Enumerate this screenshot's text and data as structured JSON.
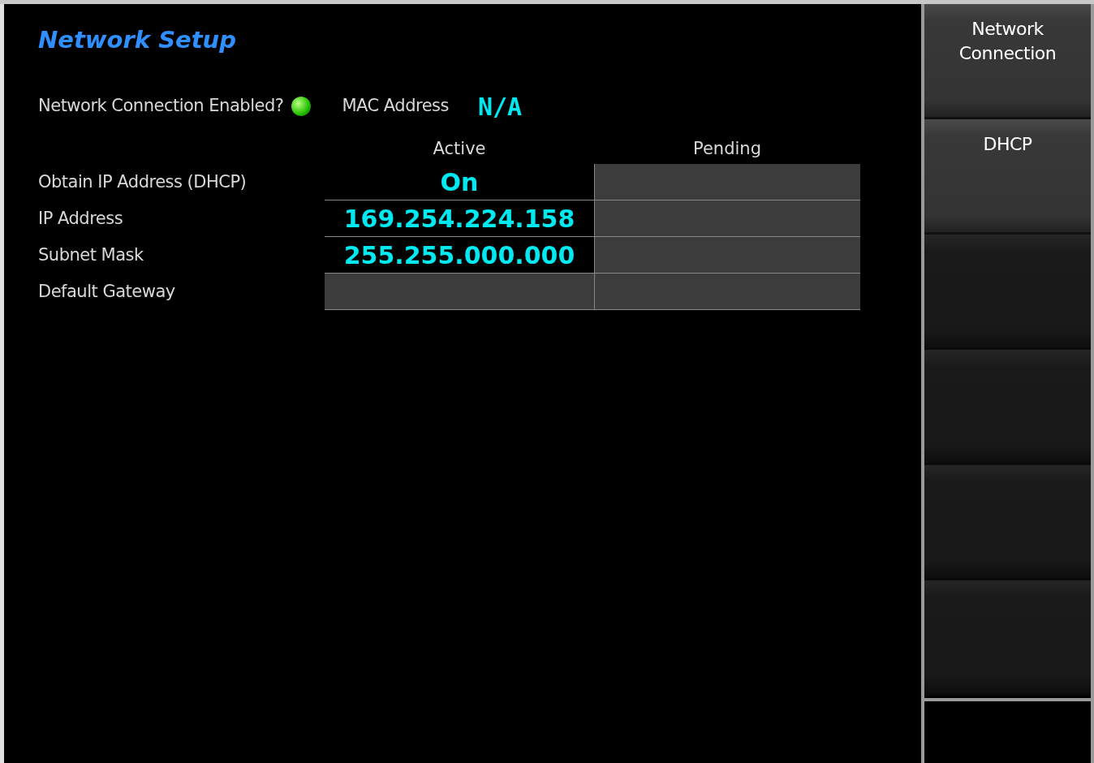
{
  "title": "Network Setup",
  "status": {
    "label": "Network Connection Enabled?",
    "enabled": true,
    "mac_label": "MAC Address",
    "mac_value": "N/A"
  },
  "table": {
    "columns": [
      "Active",
      "Pending"
    ],
    "rows": [
      {
        "label": "Obtain IP Address (DHCP)",
        "active": "On"
      },
      {
        "label": "IP Address",
        "active": "169.254.224.158"
      },
      {
        "label": "Subnet Mask",
        "active": "255.255.000.000"
      },
      {
        "label": "Default Gateway"
      }
    ]
  },
  "softkeys": [
    {
      "kind": "label",
      "label": "Network Connection"
    },
    {
      "kind": "label",
      "label": "DHCP"
    },
    {
      "kind": "blank"
    },
    {
      "kind": "blank"
    },
    {
      "kind": "blank"
    },
    {
      "kind": "blank"
    }
  ]
}
